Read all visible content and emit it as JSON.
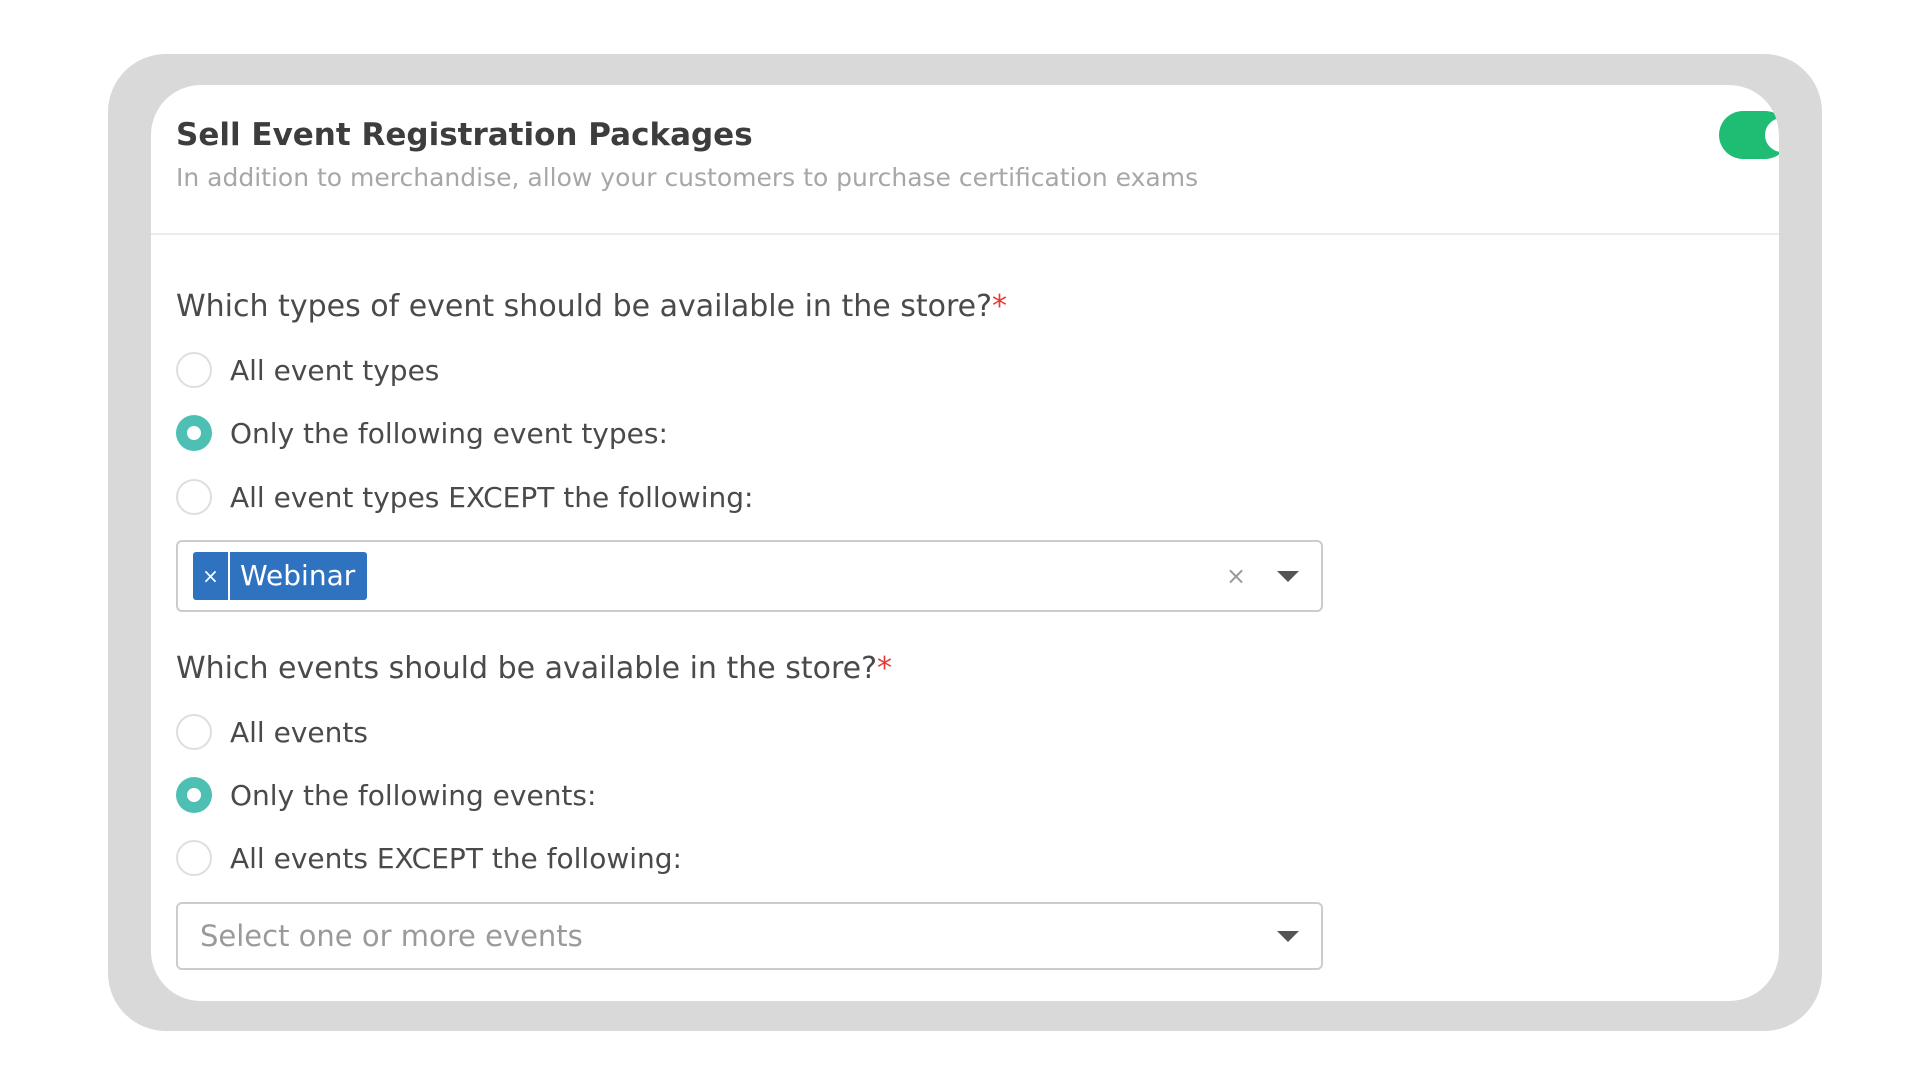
{
  "header": {
    "title": "Sell Event Registration Packages",
    "subtitle": "In addition to merchandise, allow your customers to purchase certification exams",
    "toggle_on": true,
    "toggle_color": "#1fbd73"
  },
  "event_types": {
    "question": "Which types of event should be available in the store?",
    "required_mark": "*",
    "options": [
      {
        "label": "All event types",
        "checked": false
      },
      {
        "label": "Only the following event types:",
        "checked": true
      },
      {
        "label": "All event types EXCEPT the following:",
        "checked": false
      }
    ],
    "selected_tags": [
      {
        "label": "Webinar",
        "remove_glyph": "×"
      }
    ],
    "clear_glyph": "×"
  },
  "events": {
    "question": "Which events should be available in the store?",
    "required_mark": "*",
    "options": [
      {
        "label": "All events",
        "checked": false
      },
      {
        "label": "Only the following events:",
        "checked": true
      },
      {
        "label": "All events EXCEPT the following:",
        "checked": false
      }
    ],
    "placeholder": "Select one or more events"
  },
  "colors": {
    "radio_checked": "#4dbfb3",
    "tag_background": "#2f73c0",
    "required": "#e53935"
  }
}
